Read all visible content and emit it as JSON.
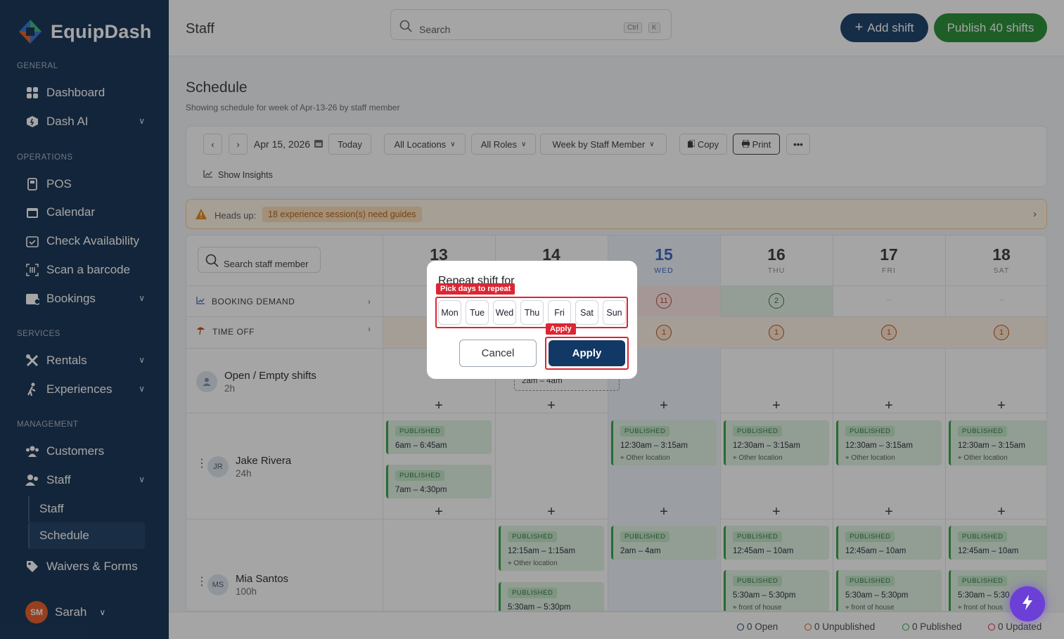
{
  "app": {
    "name": "EquipDash"
  },
  "sidebar": {
    "sections": {
      "general": "GENERAL",
      "operations": "OPERATIONS",
      "services": "SERVICES",
      "management": "MANAGEMENT"
    },
    "items": {
      "dashboard": "Dashboard",
      "dash_ai": "Dash AI",
      "pos": "POS",
      "calendar": "Calendar",
      "check_availability": "Check Availability",
      "scan_barcode": "Scan a barcode",
      "bookings": "Bookings",
      "rentals": "Rentals",
      "experiences": "Experiences",
      "customers": "Customers",
      "staff": "Staff",
      "staff_sub": "Staff",
      "schedule": "Schedule",
      "waivers": "Waivers & Forms"
    },
    "user": {
      "initials": "SM",
      "name": "Sarah"
    }
  },
  "header": {
    "title": "Staff",
    "search_placeholder": "Search",
    "kbd_ctrl": "Ctrl",
    "kbd_k": "K",
    "add_shift": "Add shift",
    "publish": "Publish 40 shifts"
  },
  "schedule": {
    "title": "Schedule",
    "subtitle": "Showing schedule for week of Apr-13-26 by staff member"
  },
  "toolbar": {
    "date": "Apr 15, 2026",
    "today": "Today",
    "locations": "All Locations",
    "roles": "All Roles",
    "view": "Week by Staff Member",
    "copy": "Copy",
    "print": "Print",
    "more": "•••",
    "insights": "Show Insights"
  },
  "headsup": {
    "label": "Heads up:",
    "badge": "18 experience session(s) need guides"
  },
  "grid": {
    "search_staff": "Search staff member",
    "days": [
      {
        "num": "13",
        "name": ""
      },
      {
        "num": "14",
        "name": ""
      },
      {
        "num": "15",
        "name": "WED"
      },
      {
        "num": "16",
        "name": "THU"
      },
      {
        "num": "17",
        "name": "FRI"
      },
      {
        "num": "18",
        "name": "SAT"
      }
    ],
    "booking_demand": "BOOKING DEMAND",
    "time_off": "TIME OFF",
    "demand_values": {
      "wed": "11",
      "thu": "2",
      "fri": "–",
      "sat": "–"
    },
    "timeoff_values": {
      "wed": "1",
      "thu": "1",
      "fri": "1",
      "sat": "1"
    },
    "open_row": {
      "name": "Open / Empty shifts",
      "hours": "2h",
      "shift_time": "2am – 4am"
    },
    "jake": {
      "initials": "JR",
      "name": "Jake Rivera",
      "hours": "24h"
    },
    "mia": {
      "initials": "MS",
      "name": "Mia Santos",
      "hours": "100h"
    },
    "published": "PUBLISHED",
    "other_location": "Other location",
    "front_of_house": "front of house",
    "front_of_house_cut": "front of hous",
    "shift_times": {
      "j1": "6am – 6:45am",
      "j2": "7am – 4:30pm",
      "j3": "12:30am – 3:15am",
      "m1": "12:15am – 1:15am",
      "m2": "5:30am – 5:30pm",
      "m3": "2am – 4am",
      "m4": "12:45am – 10am",
      "m5": "5:30am – 5:30pm",
      "m6": "5:30am – 5:30"
    }
  },
  "status": {
    "open": "0 Open",
    "unpublished": "0 Unpublished",
    "published": "0 Published",
    "updated": "0 Updated"
  },
  "modal": {
    "title": "Repeat shift for",
    "tag_days": "Pick days to repeat",
    "tag_apply": "Apply",
    "days": [
      "Mon",
      "Tue",
      "Wed",
      "Thu",
      "Fri",
      "Sat",
      "Sun"
    ],
    "cancel": "Cancel",
    "apply": "Apply"
  }
}
